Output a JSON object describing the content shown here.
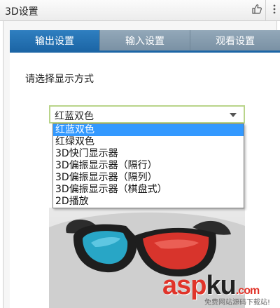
{
  "window": {
    "title": "3D设置"
  },
  "titlebar": {
    "icons": [
      "thumbs-up-icon",
      "more-icon"
    ]
  },
  "tabs": [
    {
      "label": "输出设置",
      "active": true
    },
    {
      "label": "输入设置",
      "active": false
    },
    {
      "label": "观看设置",
      "active": false
    }
  ],
  "display_mode": {
    "prompt": "请选择显示方式",
    "selected_value": "红蓝双色",
    "options": [
      {
        "label": "红蓝双色",
        "highlighted": true
      },
      {
        "label": "红绿双色",
        "highlighted": false
      },
      {
        "label": "3D快门显示器",
        "highlighted": false
      },
      {
        "label": "3D偏振显示器（隔行）",
        "highlighted": false
      },
      {
        "label": "3D偏振显示器（隔列）",
        "highlighted": false
      },
      {
        "label": "3D偏振显示器（棋盘式）",
        "highlighted": false
      },
      {
        "label": "2D播放",
        "highlighted": false
      }
    ]
  },
  "preview": {
    "image": "3d-glasses-image"
  },
  "watermark": {
    "brand_asp": "asp",
    "brand_ku": "ku",
    "brand_com": ".com",
    "subtitle": "免费网站源码下载站!"
  },
  "colors": {
    "tab_active": "#1c66a6",
    "tab_inactive": "#8ba1b3",
    "selection": "#3399ff",
    "select_border": "#b9d48a",
    "lens_red": "#d8342c",
    "lens_blue": "#28a6c6",
    "watermark_red": "#e0342a"
  }
}
